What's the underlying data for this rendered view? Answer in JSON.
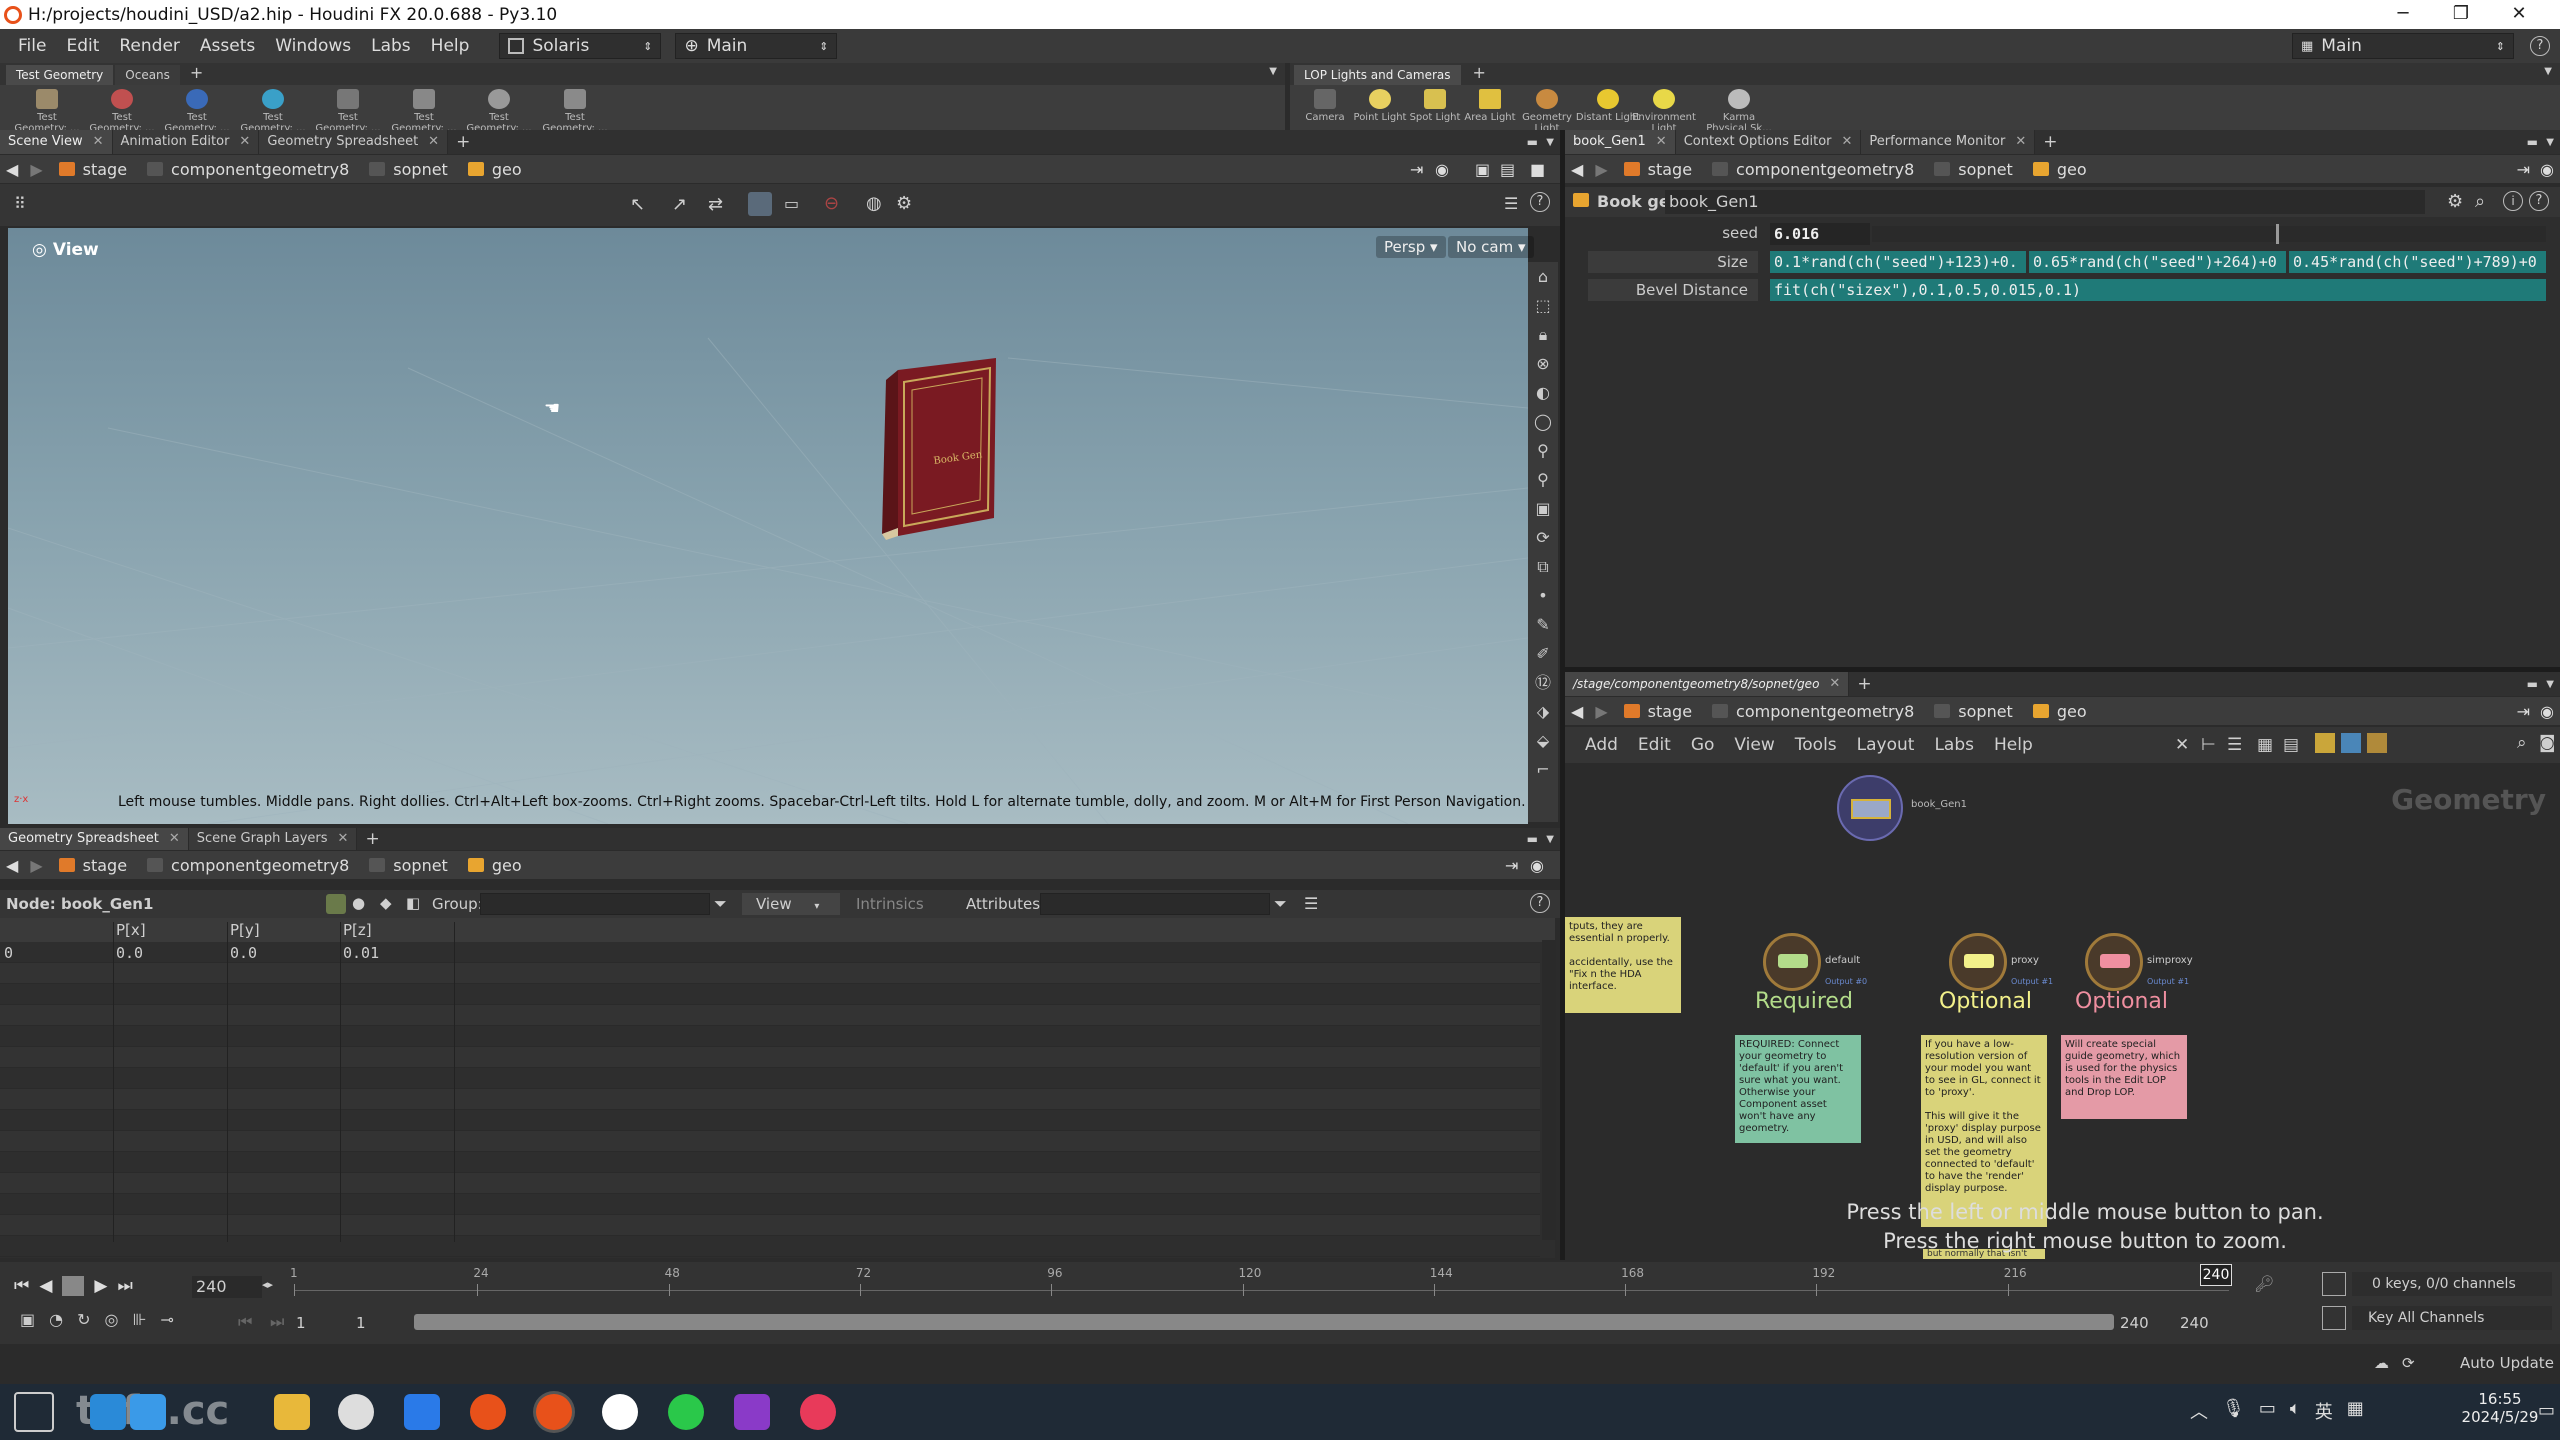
{
  "window": {
    "title": "H:/projects/houdini_USD/a2.hip - Houdini FX 20.0.688 - Py3.10",
    "controls": [
      "─",
      "❐",
      "✕"
    ]
  },
  "menubar": {
    "items": [
      "File",
      "Edit",
      "Render",
      "Assets",
      "Windows",
      "Labs",
      "Help"
    ],
    "desktop": "Solaris",
    "main_combo": "Main",
    "right_combo": "Main"
  },
  "shelf_left": {
    "tabs": [
      "Test Geometry",
      "Oceans"
    ],
    "tools": [
      "Test Geometry: ...",
      "Test Geometry: ...",
      "Test Geometry: ...",
      "Test Geometry: ...",
      "Test Geometry: ...",
      "Test Geometry: ...",
      "Test Geometry: ...",
      "Test Geometry: ..."
    ]
  },
  "shelf_right": {
    "tabs": [
      "LOP Lights and Cameras"
    ],
    "tools": [
      "Camera",
      "Point Light",
      "Spot Light",
      "Area Light",
      "Geometry Light",
      "Distant Light",
      "Environment Light",
      "Karma Physical Sk..."
    ]
  },
  "viewer": {
    "tabs": [
      "Scene View",
      "Animation Editor",
      "Geometry Spreadsheet"
    ],
    "path": [
      "stage",
      "componentgeometry8",
      "sopnet",
      "geo"
    ],
    "view_label": "View",
    "persp": "Persp",
    "cam": "No cam",
    "status": "Left mouse tumbles. Middle pans. Right dollies. Ctrl+Alt+Left box-zooms. Ctrl+Right zooms. Spacebar-Ctrl-Left tilts. Hold L for alternate tumble, dolly, and zoom. M or Alt+M for First Person Navigation."
  },
  "spreadsheet": {
    "tabs": [
      "Geometry Spreadsheet",
      "Scene Graph Layers"
    ],
    "path": [
      "stage",
      "componentgeometry8",
      "sopnet",
      "geo"
    ],
    "node_label": "Node: book_Gen1",
    "group_label": "Group:",
    "view_label": "View",
    "intrinsics_label": "Intrinsics",
    "attributes_label": "Attributes:",
    "columns": [
      "",
      "P[x]",
      "P[y]",
      "P[z]"
    ],
    "rows": [
      [
        "0",
        "0.0",
        "0.0",
        "0.01"
      ]
    ]
  },
  "params": {
    "tabs": [
      "book_Gen1",
      "Context Options Editor",
      "Performance Monitor"
    ],
    "path": [
      "stage",
      "componentgeometry8",
      "sopnet",
      "geo"
    ],
    "node_type": "Book gen",
    "node_name": "book_Gen1",
    "seed_label": "seed",
    "seed_value": "6.016",
    "seed_fraction": 0.6,
    "size_label": "Size",
    "size_values": [
      "0.1*rand(ch(\"seed\")+123)+0.",
      "0.65*rand(ch(\"seed\")+264)+0",
      "0.45*rand(ch(\"seed\")+789)+0"
    ],
    "bevel_label": "Bevel Distance",
    "bevel_value": "fit(ch(\"sizex\"),0.1,0.5,0.015,0.1)"
  },
  "network": {
    "tab": "/stage/componentgeometry8/sopnet/geo",
    "path": [
      "stage",
      "componentgeometry8",
      "sopnet",
      "geo"
    ],
    "menu": [
      "Add",
      "Edit",
      "Go",
      "View",
      "Tools",
      "Layout",
      "Labs",
      "Help"
    ],
    "context_label": "Geometry",
    "node_name": "book_Gen1",
    "outputs": [
      {
        "name": "default",
        "sub": "Output #0",
        "label": "Required",
        "color": "#b3dc8a"
      },
      {
        "name": "proxy",
        "sub": "Output #1",
        "label": "Optional",
        "color": "#f2f08a"
      },
      {
        "name": "simproxy",
        "sub": "Output #1",
        "label": "Optional",
        "color": "#ef8fa0"
      }
    ],
    "sticky_partial": "tputs, they are essential n properly.\n\naccidentally, use the \"Fix n the HDA interface.",
    "sticky_required": "REQUIRED: Connect your geometry to 'default' if you aren't sure what you want. Otherwise your Component asset won't have any geometry.",
    "sticky_proxy": "If you have a low-resolution version of your model you want to see in GL, connect it to 'proxy'.\n\nThis will give it the 'proxy' display purpose in USD, and will also set the geometry connected to 'default' to have the 'render' display purpose.",
    "sticky_proxy_tail": "but normally that isn't",
    "sticky_sim": "Will create special guide geometry, which is used for the physics tools in the Edit LOP and Drop LOP.",
    "hint1": "Press the left or middle mouse button to pan.",
    "hint2": "Press the right mouse button to zoom."
  },
  "timeline": {
    "current_frame": "240",
    "ticks": [
      "1",
      "24",
      "48",
      "72",
      "96",
      "120",
      "144",
      "168",
      "192",
      "216"
    ],
    "marker": "240",
    "range_start": "1",
    "range_start2": "1",
    "range_end": "240",
    "range_end2": "240",
    "keys": "0 keys, 0/0 channels",
    "key_all": "Key All Channels",
    "auto_update": "Auto Update"
  },
  "taskbar": {
    "time": "16:55",
    "date": "2024/5/29",
    "ime": "英",
    "watermark": "tafe.cc"
  }
}
